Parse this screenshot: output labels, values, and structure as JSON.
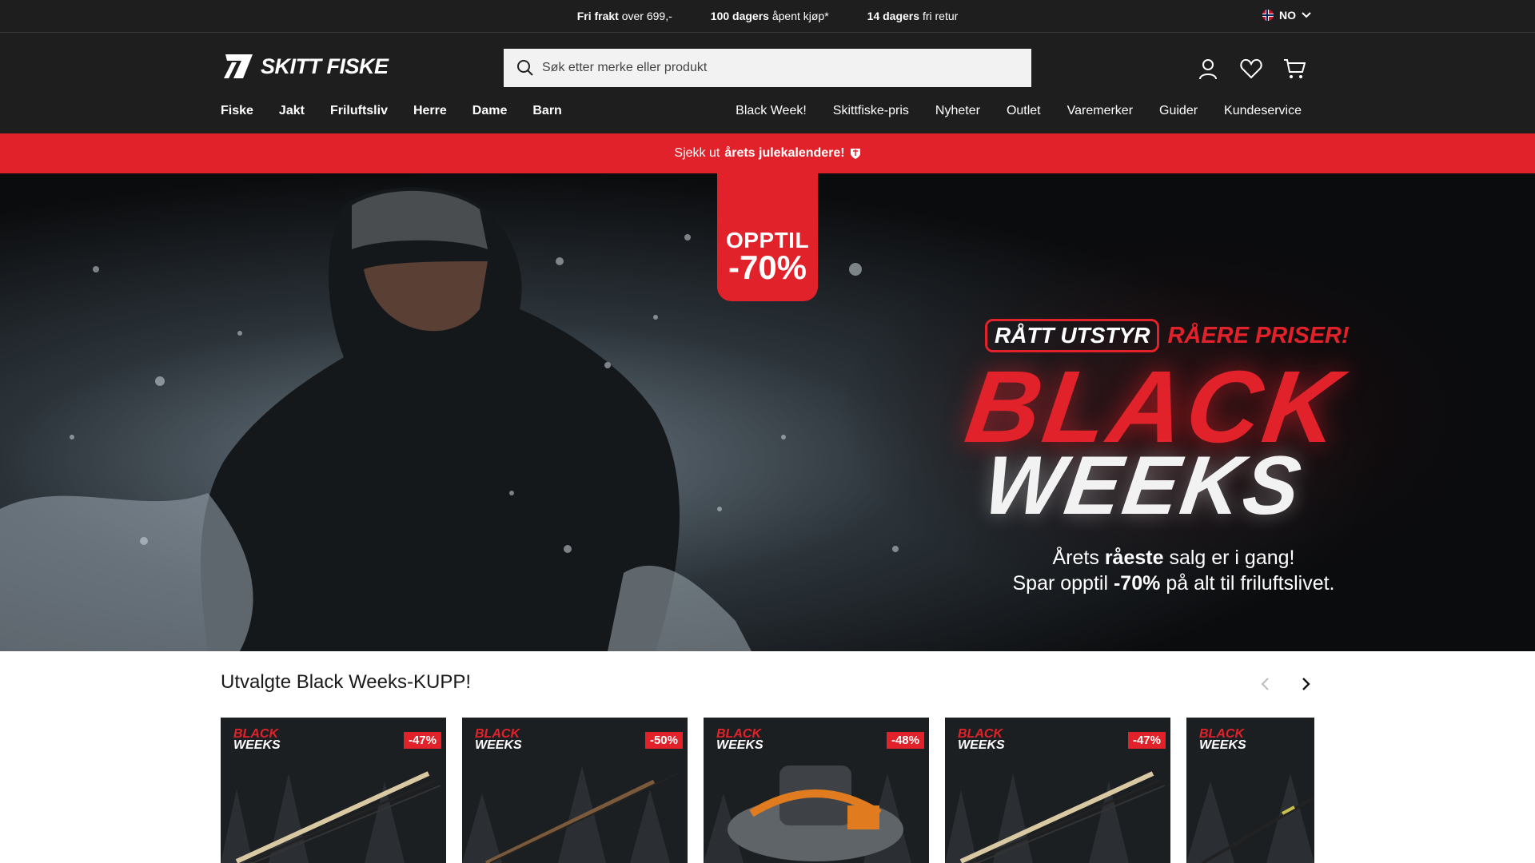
{
  "topbar": {
    "usps": [
      {
        "bold": "Fri frakt",
        "rest": "over 699,-"
      },
      {
        "bold": "100 dagers",
        "rest": "åpent kjøp*"
      },
      {
        "bold": "14 dagers",
        "rest": "fri retur"
      }
    ],
    "language": "NO"
  },
  "header": {
    "logo_text": "SKITT FISKE",
    "search_placeholder": "Søk etter merke eller produkt",
    "icons": [
      "account-icon",
      "wishlist-heart-icon",
      "cart-icon"
    ],
    "nav_left": [
      "Fiske",
      "Jakt",
      "Friluftsliv",
      "Herre",
      "Dame",
      "Barn"
    ],
    "nav_right": [
      "Black Week!",
      "Skittfiske-pris",
      "Nyheter",
      "Outlet",
      "Varemerker",
      "Guider",
      "Kundeservice"
    ]
  },
  "promo": {
    "prefix": "Sjekk ut",
    "bold": "årets julekalendere!",
    "icon": "gift-shield-icon"
  },
  "hero": {
    "badge_line1": "OPPTIL",
    "badge_line2": "-70%",
    "slogan_boxed": "RÅTT UTSTYR",
    "slogan_red": "RÅERE PRISER!",
    "title_black": "BLACK",
    "title_weeks": "WEEKS",
    "line1_a": "Årets",
    "line1_bold": "råeste",
    "line1_b": "salg er i gang!",
    "line2_a": "Spar opptil",
    "line2_bold": "-70%",
    "line2_b": "på alt til friluftslivet."
  },
  "products": {
    "heading": "Utvalgte Black Weeks-KUPP!",
    "card_badge_top": "BLACK",
    "card_badge_bottom": "WEEKS",
    "items": [
      {
        "discount": "-47%",
        "kind": "rod"
      },
      {
        "discount": "-50%",
        "kind": "rod"
      },
      {
        "discount": "-48%",
        "kind": "float-tube"
      },
      {
        "discount": "-47%",
        "kind": "rod"
      },
      {
        "discount": "",
        "kind": "rod"
      }
    ]
  },
  "colors": {
    "accent_red": "#e2222a",
    "header_bg": "#1e1e1e"
  }
}
